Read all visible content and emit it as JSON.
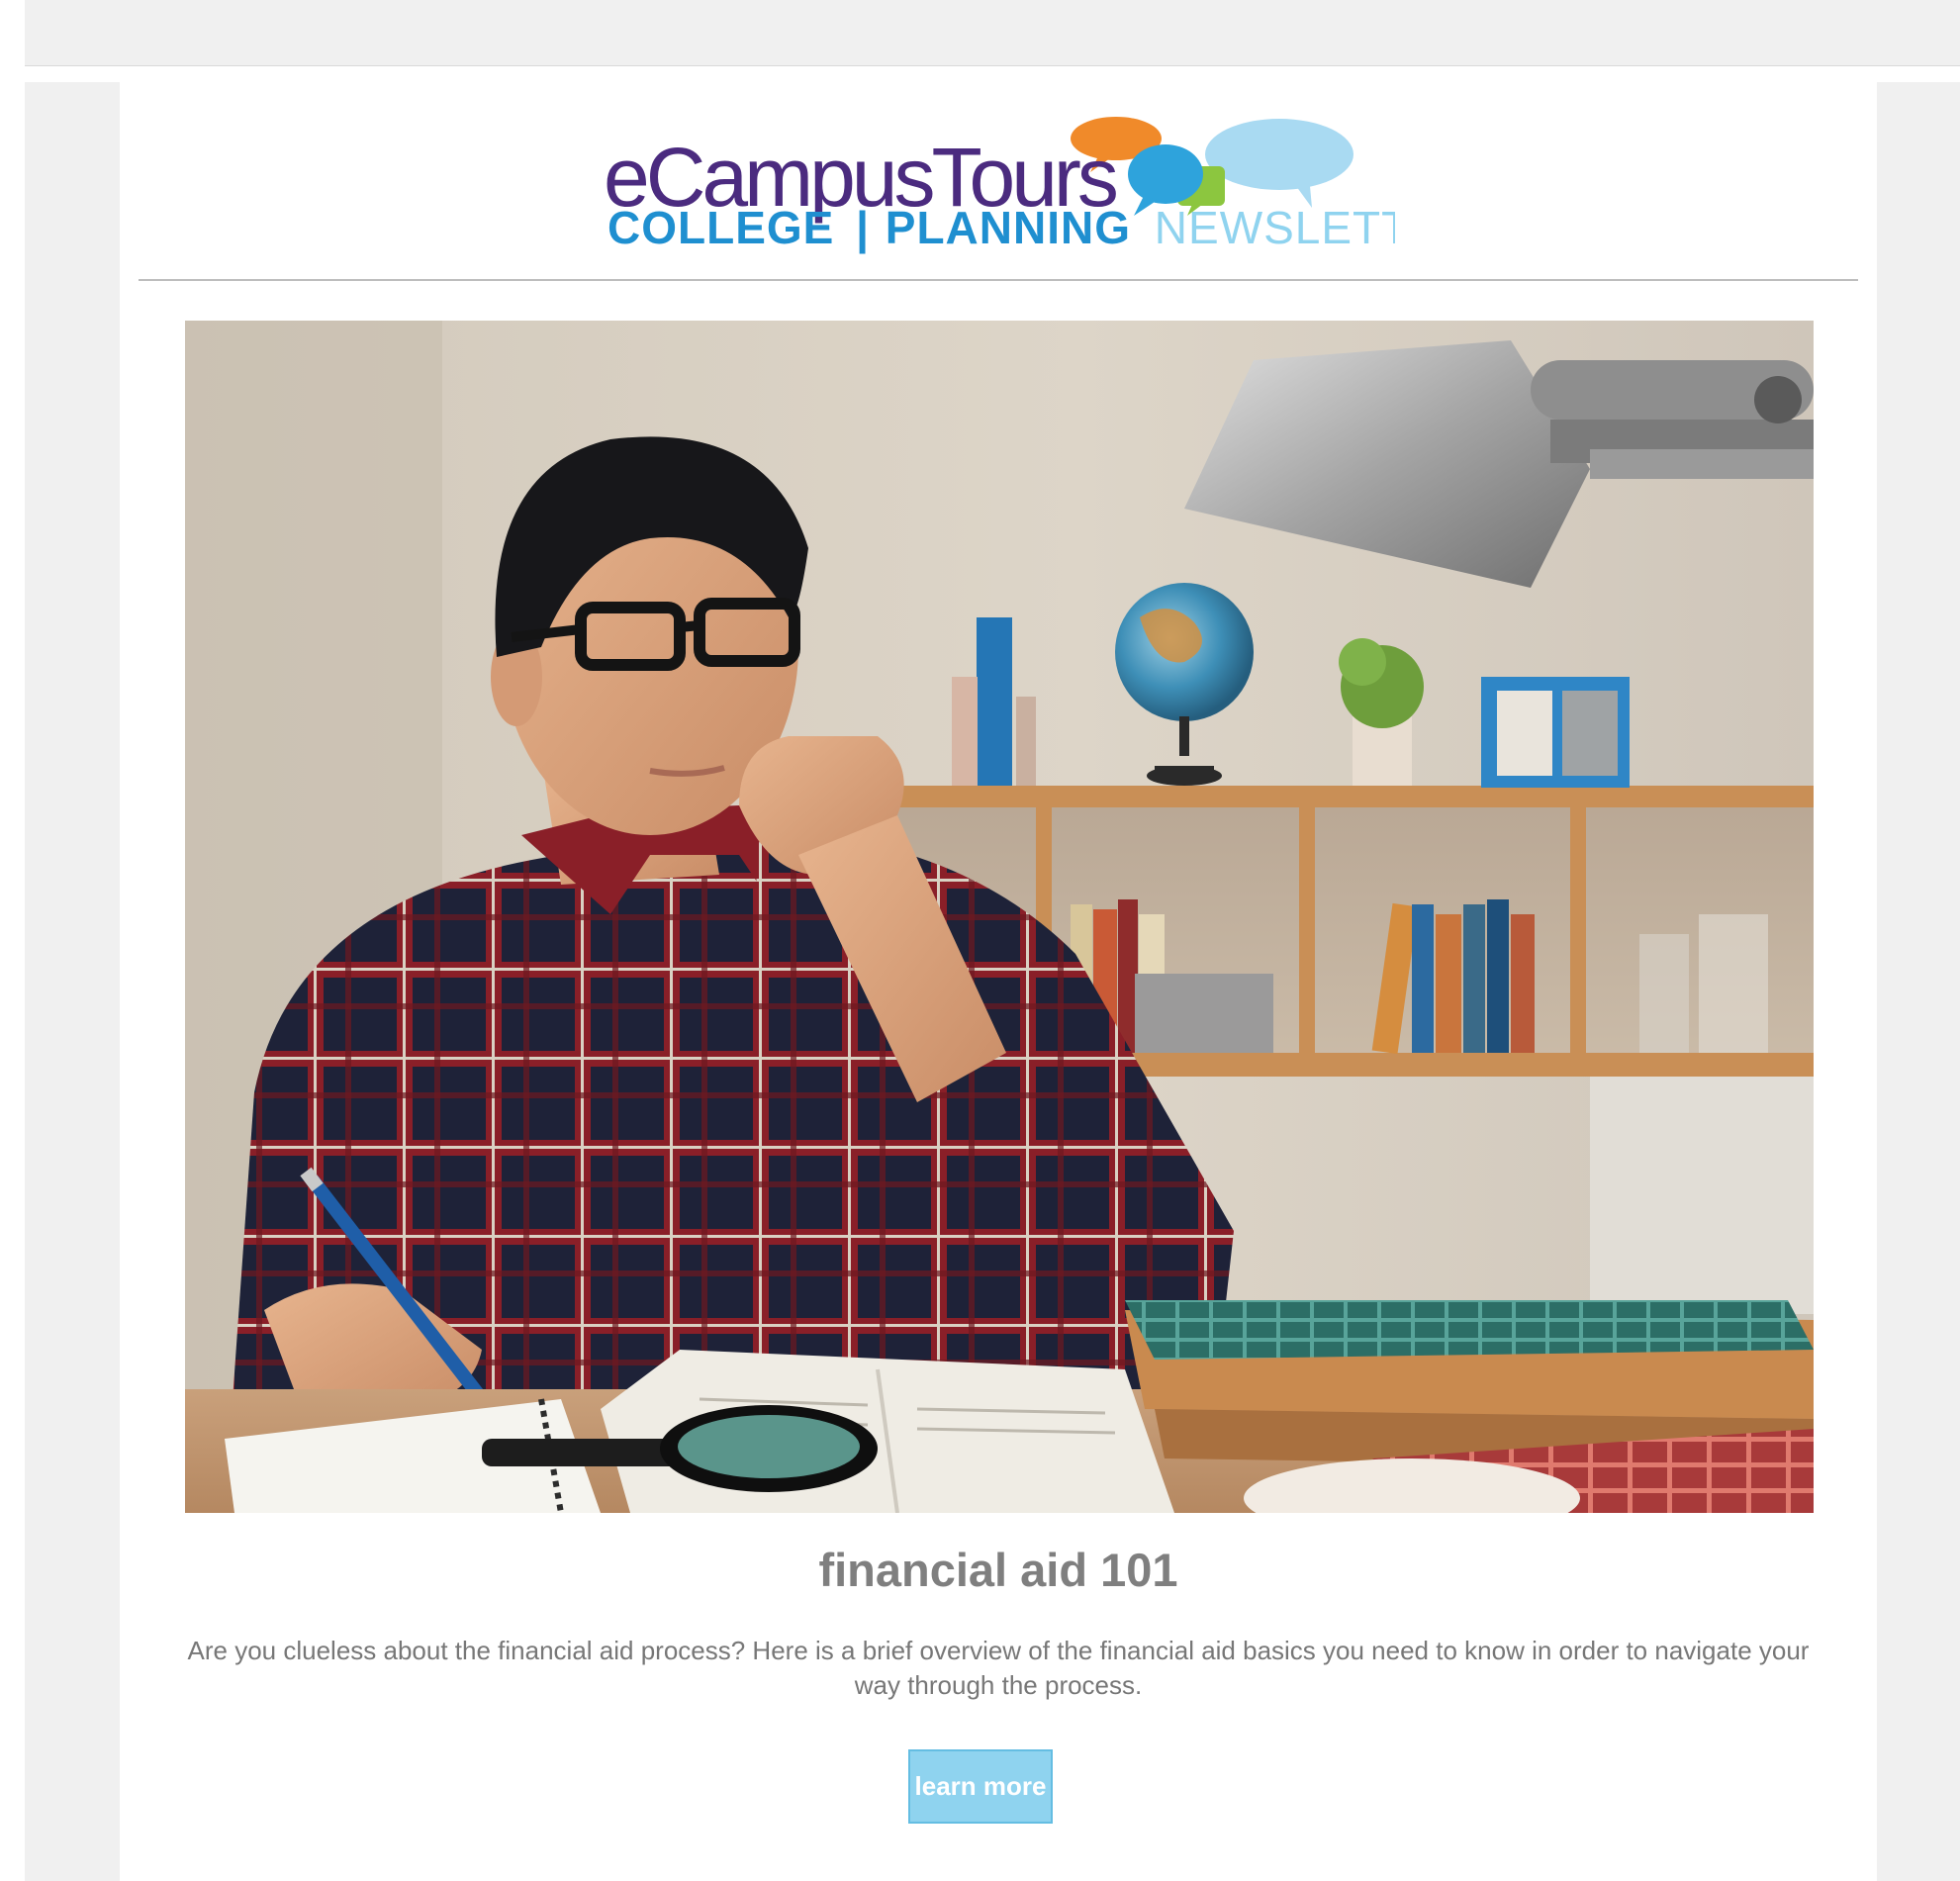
{
  "logo": {
    "brand_name": "eCampusTours",
    "tagline_part1": "COLLEGE",
    "tagline_part2": "PLANNING",
    "tagline_part3": "NEWSLETTER"
  },
  "article": {
    "title": "financial aid 101",
    "body": "Are you clueless about the financial aid process? Here is a brief overview of the financial aid basics you need to know in order to navigate your way through the process.",
    "button_label": "learn more"
  },
  "hero_image": {
    "icon": "student-studying-photo"
  },
  "colors": {
    "brand_purple": "#4b2b7f",
    "tagline_blue": "#1f8fd0",
    "tagline_light_blue": "#8fd3ef",
    "headline_gray": "#7f7f7f",
    "button_blue": "#8fd3ef",
    "speech_orange": "#f08a2a",
    "speech_blue": "#2ea3dc",
    "speech_green": "#8cc63f",
    "speech_light_blue": "#a9daf2"
  }
}
